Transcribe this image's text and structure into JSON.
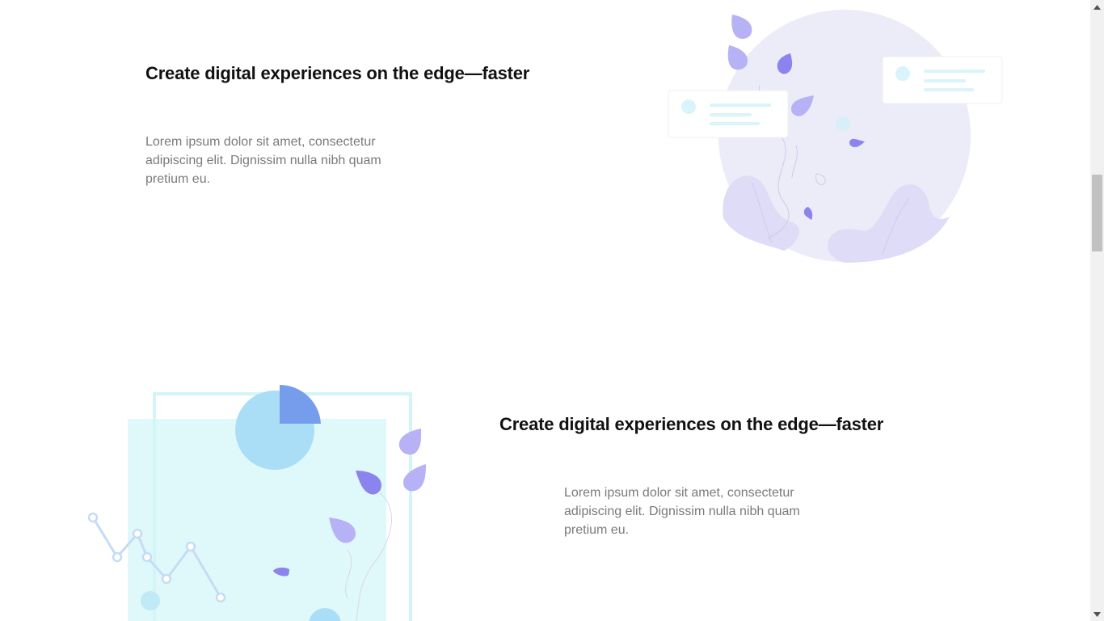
{
  "features": [
    {
      "heading": "Create digital experiences on the edge—faster",
      "body": "Lorem ipsum dolor sit amet, consectetur adipiscing elit. Dignissim nulla nibh quam pretium eu."
    },
    {
      "heading": "Create digital experiences on the edge—faster",
      "body": "Lorem ipsum dolor sit amet, consectetur adipiscing elit. Dignissim nulla nibh quam pretium eu."
    }
  ],
  "colors": {
    "heading": "#111111",
    "body": "#7a7a7a",
    "planet": "#ecebf8",
    "leaf_light": "#b7b2f6",
    "leaf_dark": "#8c84ee",
    "cyan_panel": "#dff9fa",
    "pie_light": "#a9def6",
    "pie_dark": "#769cec"
  },
  "icons": {
    "scroll_up": "triangle-up-icon",
    "scroll_down": "triangle-down-icon"
  }
}
